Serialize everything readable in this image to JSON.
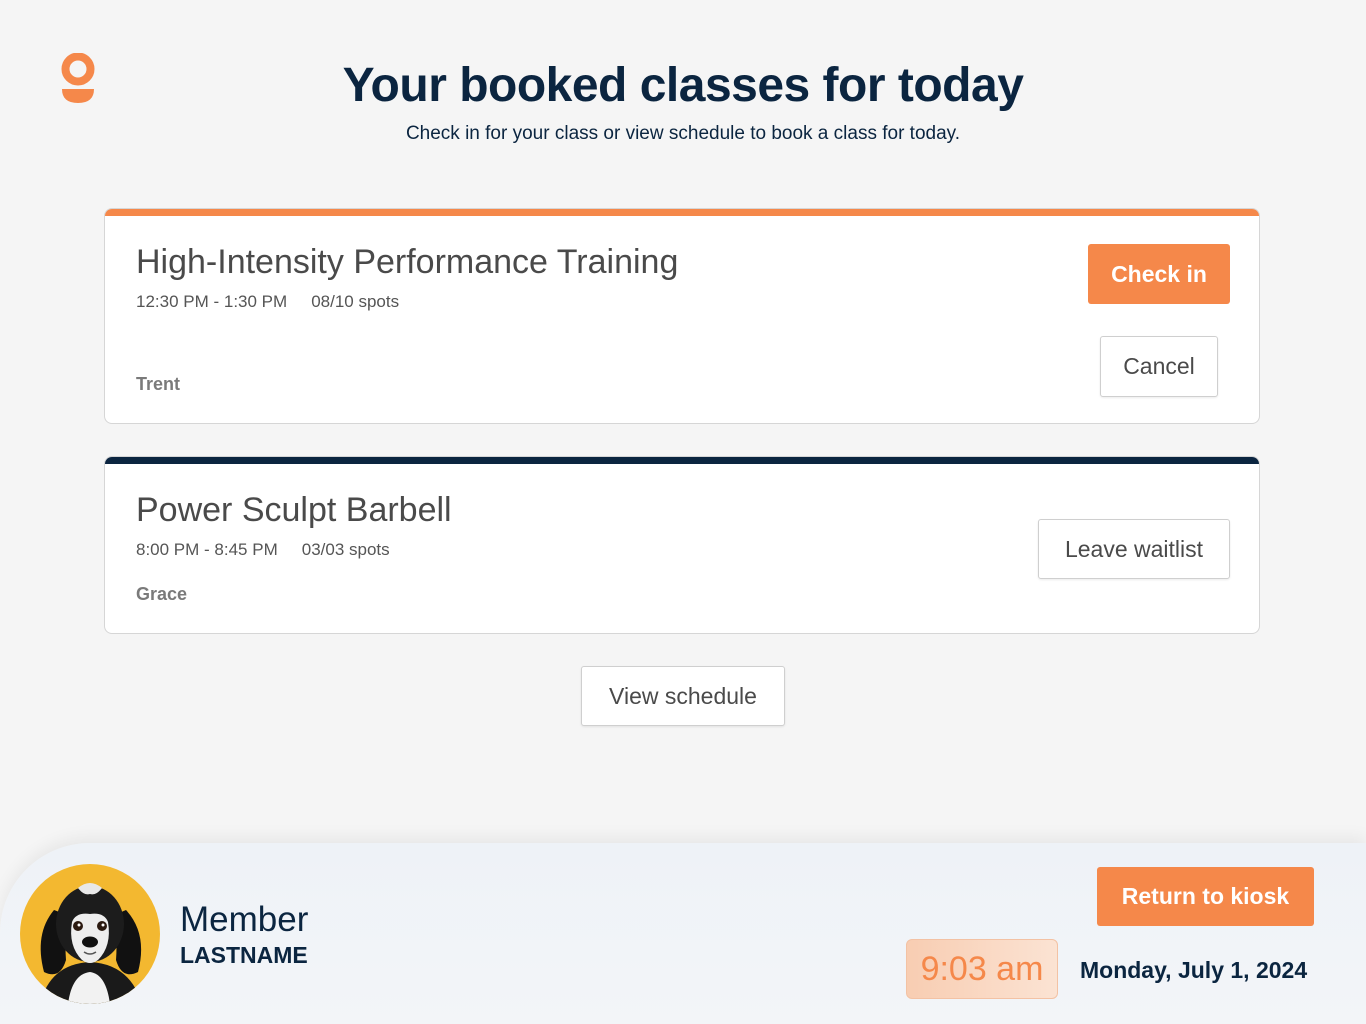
{
  "header": {
    "title": "Your booked classes for today",
    "subtitle": "Check in for your class or view schedule to book a class for today."
  },
  "classes": [
    {
      "name": "High-Intensity Performance Training",
      "time": "12:30 PM - 1:30 PM",
      "spots": "08/10 spots",
      "coach": "Trent",
      "accent": "#f5884a",
      "primary_action": "Check in",
      "secondary_action": "Cancel"
    },
    {
      "name": "Power Sculpt Barbell",
      "time": "8:00 PM - 8:45 PM",
      "spots": "03/03 spots",
      "coach": "Grace",
      "accent": "#0b2540",
      "secondary_action": "Leave waitlist"
    }
  ],
  "view_schedule_label": "View schedule",
  "footer": {
    "member_first": "Member",
    "member_last": "LASTNAME",
    "return_label": "Return to kiosk",
    "time": "9:03 am",
    "date": "Monday, July 1, 2024"
  },
  "colors": {
    "brand_orange": "#f5884a",
    "navy": "#0b2540",
    "background": "#f5f5f5"
  },
  "icons": {
    "logo": "gym-logo-icon",
    "avatar": "member-avatar-dog"
  }
}
